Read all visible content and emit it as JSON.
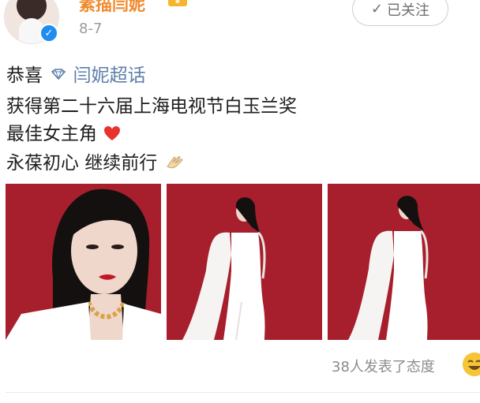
{
  "post": {
    "username": "素描闫妮",
    "date": "8-7",
    "follow_label": "已关注",
    "line1_prefix": "恭喜",
    "topic": "闫妮超话",
    "line2": "获得第二十六届上海电视节白玉兰奖",
    "line3": "最佳女主角",
    "line4": "永葆初心 继续前行",
    "reactions_text": "38人发表了态度"
  },
  "icons": {
    "verified": "verified-badge-icon",
    "crown": "vip-crown-icon",
    "follow_check": "check-icon",
    "topic": "diamond-icon",
    "heart": "red-heart-icon",
    "clap": "clapping-hands-icon",
    "reaction": "smiling-face-emoji-icon"
  },
  "colors": {
    "username": "#f08a2c",
    "topic_link": "#5c7ea8",
    "photo_background": "#a71e2c",
    "verified_badge": "#1e8cf0"
  }
}
